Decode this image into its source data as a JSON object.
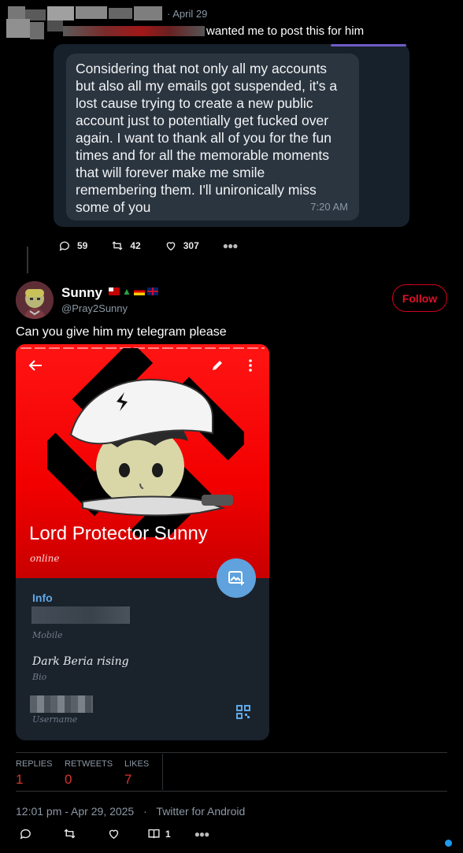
{
  "quoted_tweet": {
    "date": "· April 29",
    "text": "wanted me to post this for him",
    "message": {
      "body": "Considering that not only all my accounts but also all my emails got suspended, it's a lost cause trying to create a new public account just to potentially get fucked over again. I want to thank all of you for the fun times and for all the memorable moments that will forever make me smile remembering them. I'll unironically miss some of you",
      "time": "7:20 AM"
    },
    "replies": "59",
    "retweets": "42",
    "likes": "307"
  },
  "reply": {
    "name": "Sunny",
    "handle": "@Pray2Sunny",
    "follow_label": "Follow",
    "text": "Can you give him my telegram please",
    "accent_color": "#e0102a"
  },
  "telegram_profile": {
    "title": "Lord Protector Sunny",
    "status": "online",
    "info_header": "Info",
    "mobile_label": "Mobile",
    "bio": "Dark Beria rising",
    "bio_label": "Bio",
    "username_label": "Username",
    "background_color": "#f20000"
  },
  "stats": {
    "replies_label": "REPLIES",
    "replies_value": "1",
    "retweets_label": "RETWEETS",
    "retweets_value": "0",
    "likes_label": "LIKES",
    "likes_value": "7"
  },
  "meta": {
    "datetime": "12:01 pm - Apr 29, 2025",
    "separator": "·",
    "client": "Twitter for Android"
  },
  "bottom_actions": {
    "bookmark_count": "1"
  }
}
